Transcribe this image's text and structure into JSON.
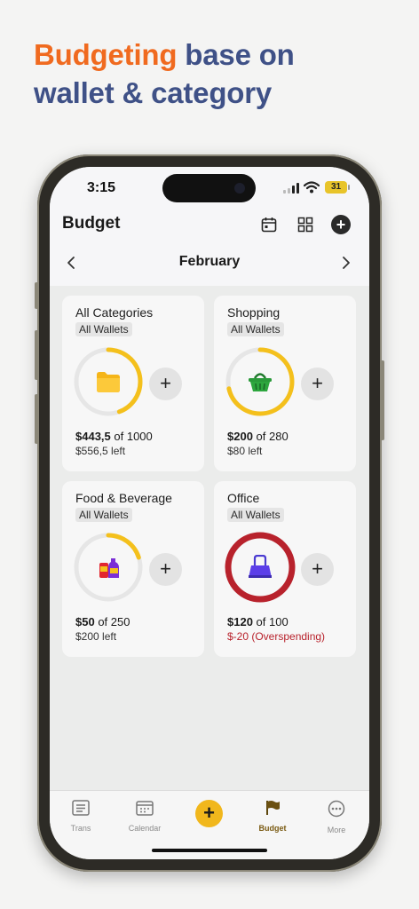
{
  "headline": {
    "accent": "Budgeting",
    "line1_rest": " base on",
    "line2": "wallet & category"
  },
  "status": {
    "time": "3:15",
    "battery": "31"
  },
  "app": {
    "title": "Budget",
    "month": "February"
  },
  "icons": {
    "calendar": "calendar-icon",
    "grid": "grid-icon",
    "add": "plus-circle-icon",
    "prev": "chevron-left-icon",
    "next": "chevron-right-icon"
  },
  "cards": [
    {
      "name": "All Categories",
      "wallet": "All Wallets",
      "spent": "$443,5",
      "of": "of 1000",
      "remaining": "$556,5 left",
      "progress": 0.4435,
      "color": "#f4c01c",
      "icon": "folder-icon",
      "plus": "+"
    },
    {
      "name": "Shopping",
      "wallet": "All Wallets",
      "spent": "$200",
      "of": "of 280",
      "remaining": "$80 left",
      "progress": 0.714,
      "color": "#f4c01c",
      "icon": "basket-icon",
      "plus": "+"
    },
    {
      "name": "Food & Beverage",
      "wallet": "All Wallets",
      "spent": "$50",
      "of": "of 250",
      "remaining": "$200 left",
      "progress": 0.2,
      "color": "#f4c01c",
      "icon": "food-icon",
      "plus": "+"
    },
    {
      "name": "Office",
      "wallet": "All Wallets",
      "spent": "$120",
      "of": "of 100",
      "remaining": "$-20 (Overspending)",
      "progress": 1.0,
      "color": "#b8222c",
      "icon": "binder-clip-icon",
      "plus": "+"
    }
  ],
  "tabs": [
    {
      "label": "Trans",
      "icon": "list-icon"
    },
    {
      "label": "Calendar",
      "icon": "calendar-icon"
    },
    {
      "label": "Budget",
      "icon": "flag-icon"
    },
    {
      "label": "More",
      "icon": "more-icon"
    }
  ],
  "fab": "+"
}
